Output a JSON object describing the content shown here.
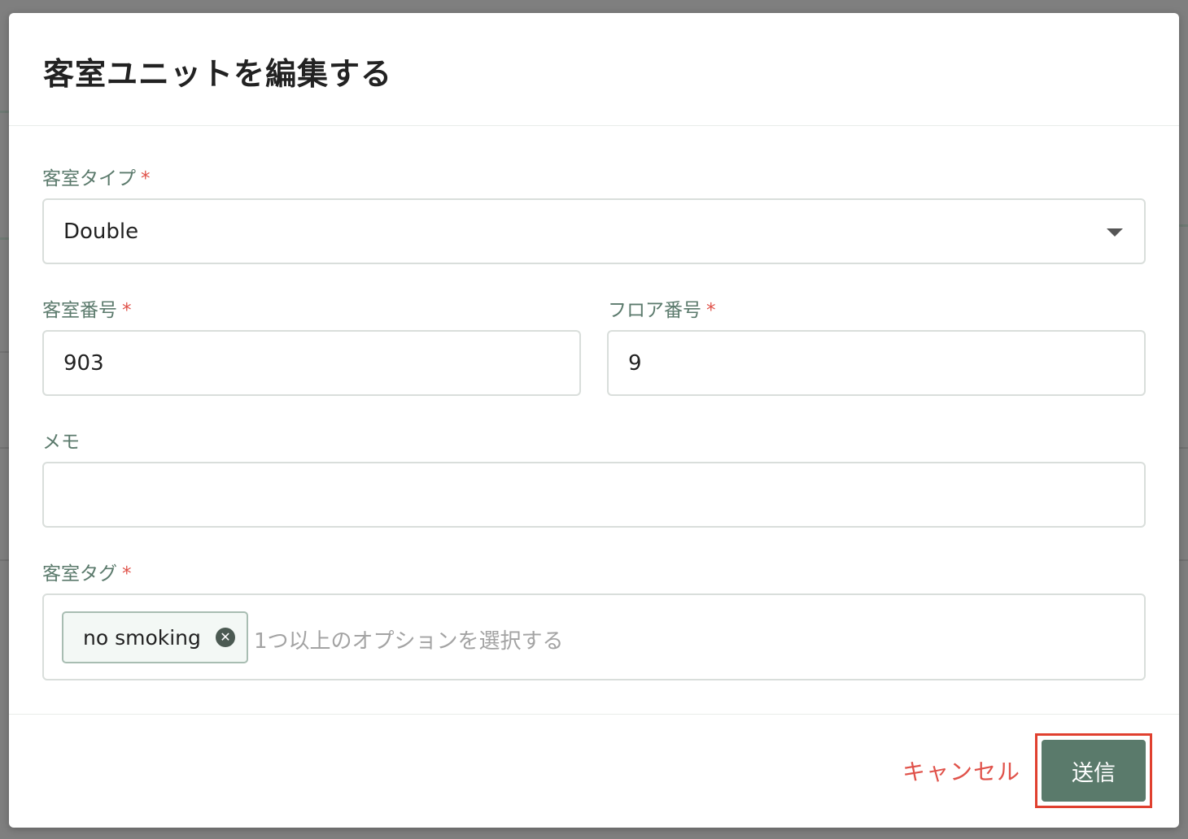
{
  "modal": {
    "title": "客室ユニットを編集する"
  },
  "form": {
    "room_type": {
      "label": "客室タイプ",
      "required_mark": "*",
      "value": "Double"
    },
    "room_number": {
      "label": "客室番号",
      "required_mark": "*",
      "value": "903"
    },
    "floor_number": {
      "label": "フロア番号",
      "required_mark": "*",
      "value": "9"
    },
    "memo": {
      "label": "メモ",
      "value": ""
    },
    "room_tags": {
      "label": "客室タグ",
      "required_mark": "*",
      "tags": [
        "no smoking"
      ],
      "placeholder": "1つ以上のオプションを選択する"
    }
  },
  "footer": {
    "cancel_label": "キャンセル",
    "submit_label": "送信"
  },
  "colors": {
    "accent": "#5a7a6b",
    "danger": "#e0524a",
    "label": "#5b7a6c"
  },
  "icons": {
    "select_caret": "caret-down-icon",
    "chip_remove": "circle-x-icon"
  }
}
